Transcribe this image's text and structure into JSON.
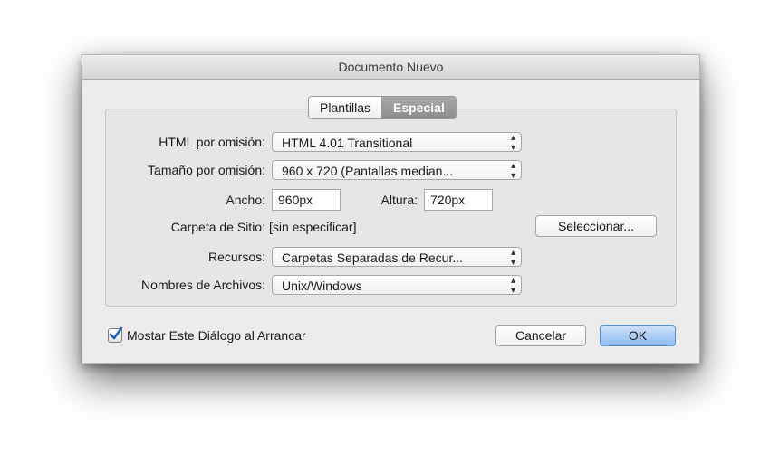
{
  "window": {
    "title": "Documento Nuevo"
  },
  "tabs": [
    {
      "label": "Plantillas",
      "active": false
    },
    {
      "label": "Especial",
      "active": true
    }
  ],
  "form": {
    "html_default": {
      "label": "HTML por omisión:",
      "value": "HTML 4.01 Transitional"
    },
    "size_default": {
      "label": "Tamaño por omisión:",
      "value": "960 x 720 (Pantallas median..."
    },
    "width": {
      "label": "Ancho:",
      "value": "960px"
    },
    "height": {
      "label": "Altura:",
      "value": "720px"
    },
    "site_folder": {
      "label": "Carpeta de Sitio:",
      "value": "[sin especificar]",
      "button": "Seleccionar..."
    },
    "resources": {
      "label": "Recursos:",
      "value": "Carpetas Separadas de Recur..."
    },
    "file_names": {
      "label": "Nombres de Archivos:",
      "value": "Unix/Windows"
    }
  },
  "footer": {
    "show_dialog": {
      "label": "Mostar Este Diálogo al Arrancar",
      "checked": true
    },
    "cancel": "Cancelar",
    "ok": "OK"
  },
  "colors": {
    "ok_button": "#8dbcf3",
    "checkbox_check": "#1f5fbf",
    "active_tab": "#9a9a9a"
  },
  "icons": {
    "select_arrows": "up-down-arrows-icon",
    "checkbox": "checkmark-icon"
  }
}
